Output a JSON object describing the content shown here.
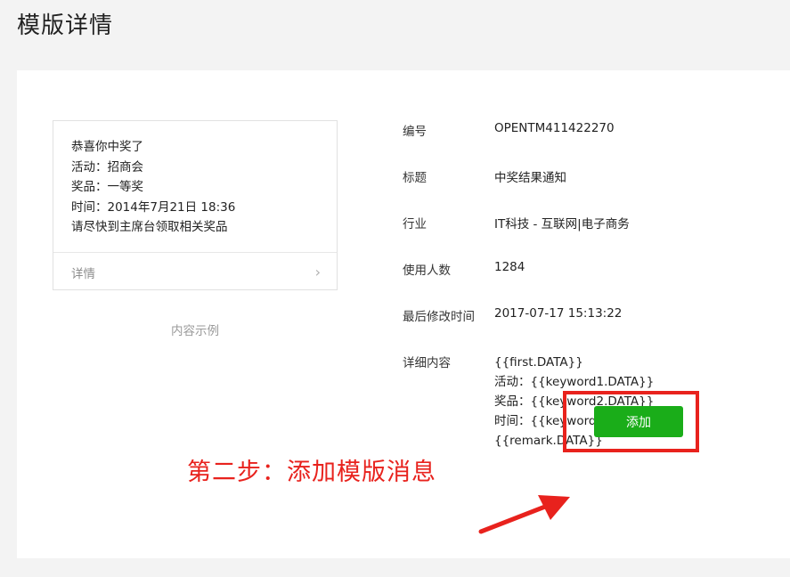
{
  "page": {
    "title": "模版详情"
  },
  "preview": {
    "lines": [
      "恭喜你中奖了",
      "活动：招商会",
      "奖品：一等奖",
      "时间：2014年7月21日 18:36",
      "请尽快到主席台领取相关奖品"
    ],
    "detail_label": "详情",
    "chevron": "›",
    "caption": "内容示例"
  },
  "info": {
    "id_label": "编号",
    "id_value": "OPENTM411422270",
    "title_label": "标题",
    "title_value": "中奖结果通知",
    "industry_label": "行业",
    "industry_value": "IT科技 - 互联网|电子商务",
    "users_label": "使用人数",
    "users_value": "1284",
    "modified_label": "最后修改时间",
    "modified_value": "2017-07-17 15:13:22",
    "content_label": "详细内容",
    "content_lines": [
      "{{first.DATA}}",
      "活动：{{keyword1.DATA}}",
      "奖品：{{keyword2.DATA}}",
      "时间：{{keyword3.DATA}}",
      "{{remark.DATA}}"
    ]
  },
  "actions": {
    "add_label": "添加"
  },
  "annotation": {
    "text": "第二步：添加模版消息",
    "color": "#e8221d"
  },
  "colors": {
    "accent": "#1aad19",
    "annotation": "#e8221d"
  },
  "icons": {
    "chevron": "chevron-right-icon",
    "arrow": "red-arrow-icon"
  }
}
